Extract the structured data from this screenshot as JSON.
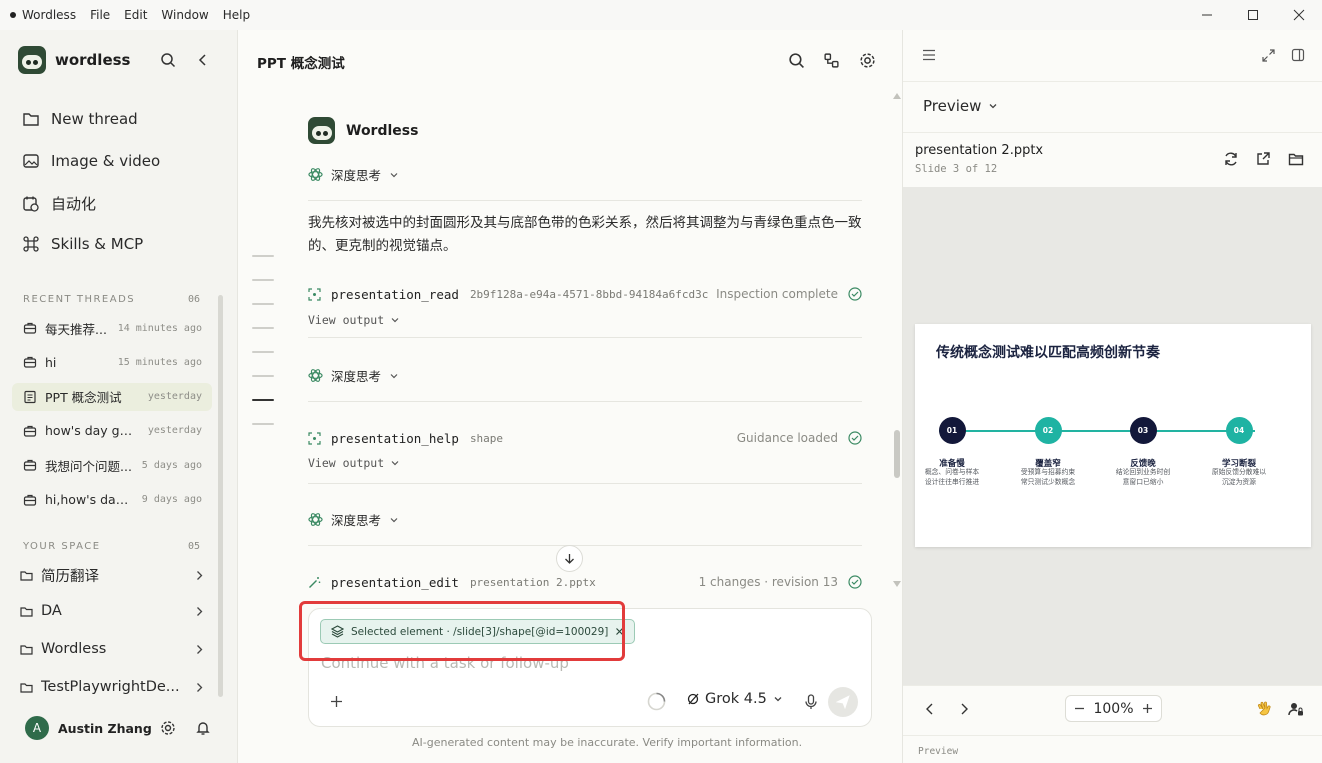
{
  "titlebar": {
    "app": "Wordless",
    "menu": [
      "File",
      "Edit",
      "Window",
      "Help"
    ]
  },
  "sidebar": {
    "brand": "wordless",
    "nav": [
      {
        "label": "New thread",
        "icon": "folder-icon"
      },
      {
        "label": "Image & video",
        "icon": "image-icon"
      },
      {
        "label": "自动化",
        "icon": "calendar-clock-icon"
      },
      {
        "label": "Skills & MCP",
        "icon": "command-icon"
      }
    ],
    "recent_title": "RECENT THREADS",
    "recent_count": "06",
    "threads": [
      {
        "label": "每天推荐...",
        "time": "14 minutes ago",
        "active": false
      },
      {
        "label": "hi",
        "time": "15 minutes ago",
        "active": false
      },
      {
        "label": "PPT 概念测试",
        "time": "yesterday",
        "active": true
      },
      {
        "label": "how's day goin...",
        "time": "yesterday",
        "active": false
      },
      {
        "label": "我想问个问题...",
        "time": "5 days ago",
        "active": false
      },
      {
        "label": "hi,how's day g...",
        "time": "9 days ago",
        "active": false
      }
    ],
    "space_title": "YOUR SPACE",
    "space_count": "05",
    "spaces": [
      "简历翻译",
      "DA",
      "Wordless",
      "TestPlaywrightDe..."
    ],
    "user": {
      "initial": "A",
      "name": "Austin Zhang"
    }
  },
  "main": {
    "title": "PPT 概念测试",
    "agent_name": "Wordless",
    "think_label": "深度思考",
    "paragraph": "我先核对被选中的封面圆形及其与底部色带的色彩关系，然后将其调整为与青绿色重点色一致的、更克制的视觉锚点。",
    "view_output": "View output",
    "tools": [
      {
        "name": "presentation_read",
        "arg": "2b9f128a-e94a-4571-8bbd-94184a6fcd3c",
        "status": "Inspection complete"
      },
      {
        "name": "presentation_help",
        "arg": "shape",
        "status": "Guidance loaded"
      },
      {
        "name": "presentation_edit",
        "arg": "presentation 2.pptx",
        "status": "1 changes · revision 13"
      }
    ],
    "composer": {
      "chip": "Selected element · /slide[3]/shape[@id=100029]",
      "placeholder": "Continue with a task or follow-up",
      "model": "Grok 4.5"
    },
    "disclaimer": "AI-generated content may be inaccurate. Verify important information."
  },
  "preview": {
    "label": "Preview",
    "file": "presentation 2.pptx",
    "slide_info": "Slide 3 of 12",
    "zoom": "100%",
    "footer": "Preview",
    "slide": {
      "title": "传统概念测试难以匹配高频创新节奏",
      "steps": [
        {
          "num": "01",
          "label": "准备慢",
          "desc": "概念、问卷与样本设计往往串行推进",
          "color": "#13183a"
        },
        {
          "num": "02",
          "label": "覆盖窄",
          "desc": "受预算与招募约束常只测试少数概念",
          "color": "#1fb3a3"
        },
        {
          "num": "03",
          "label": "反馈晚",
          "desc": "结论回到业务时创意窗口已缩小",
          "color": "#13183a"
        },
        {
          "num": "04",
          "label": "学习断裂",
          "desc": "原始反馈分散难以沉淀为资源",
          "color": "#1fb3a3"
        }
      ]
    }
  }
}
